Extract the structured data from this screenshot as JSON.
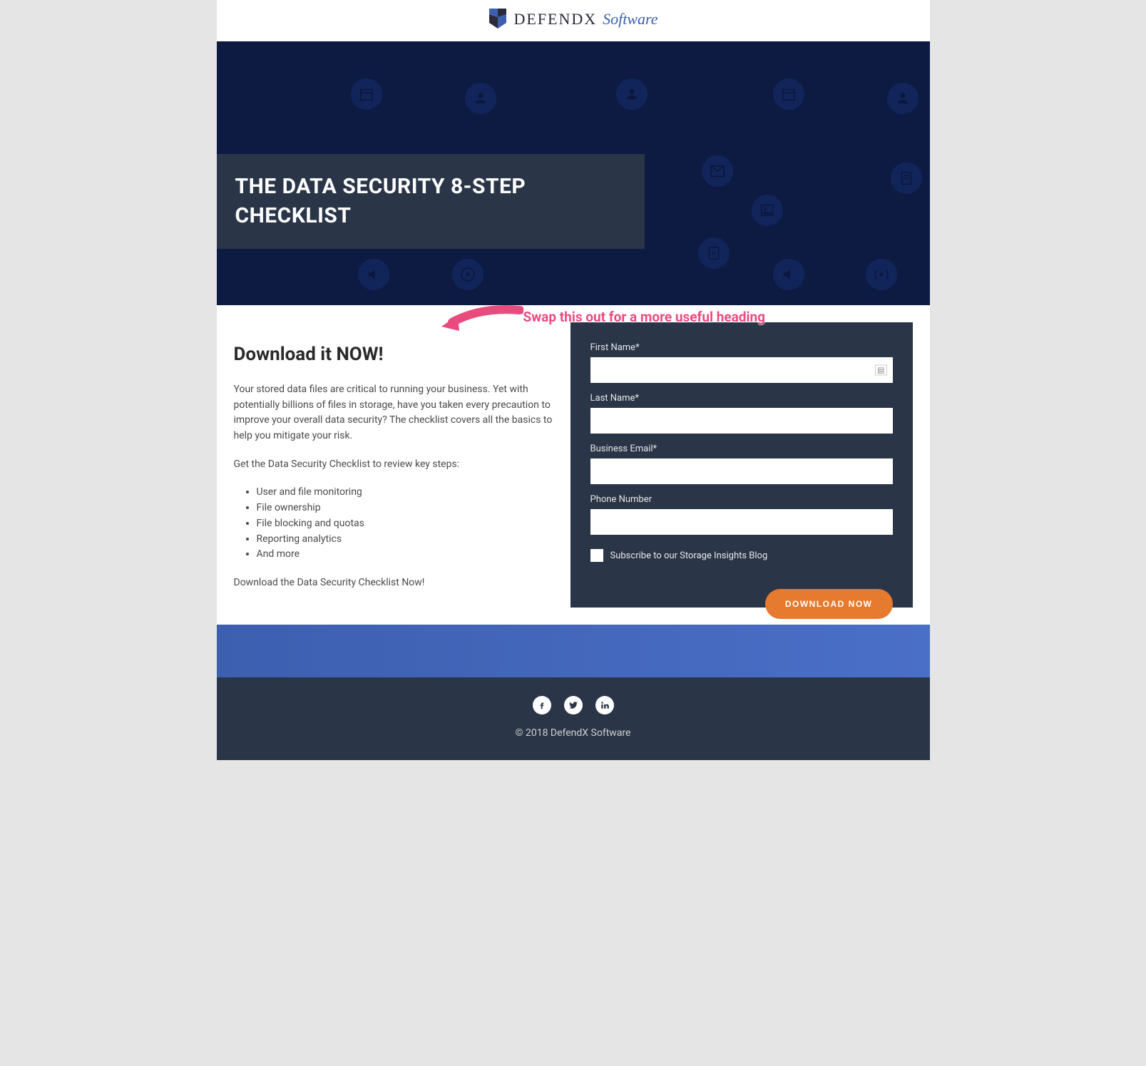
{
  "logo": {
    "main": "DEFENDX",
    "sub": "Software"
  },
  "hero": {
    "title": "THE DATA SECURITY 8-STEP CHECKLIST"
  },
  "content": {
    "heading": "Download it NOW!",
    "para1": "Your stored data files are critical to running your business. Yet with potentially billions of files in storage, have you taken every precaution to improve your overall data security? The checklist covers all the basics to help you mitigate your risk.",
    "para2": "Get the Data Security Checklist to review key steps:",
    "bullets": [
      "User and file monitoring",
      "File ownership",
      "File blocking and quotas",
      "Reporting analytics",
      "And more"
    ],
    "para3": "Download the Data Security Checklist Now!"
  },
  "annotation": {
    "text": "Swap this out for a more useful heading"
  },
  "form": {
    "first_name_label": "First Name*",
    "last_name_label": "Last Name*",
    "email_label": "Business Email*",
    "phone_label": "Phone Number",
    "subscribe_label": "Subscribe to our Storage Insights Blog",
    "submit_label": "DOWNLOAD NOW"
  },
  "footer": {
    "copyright": "© 2018 DefendX Software"
  }
}
